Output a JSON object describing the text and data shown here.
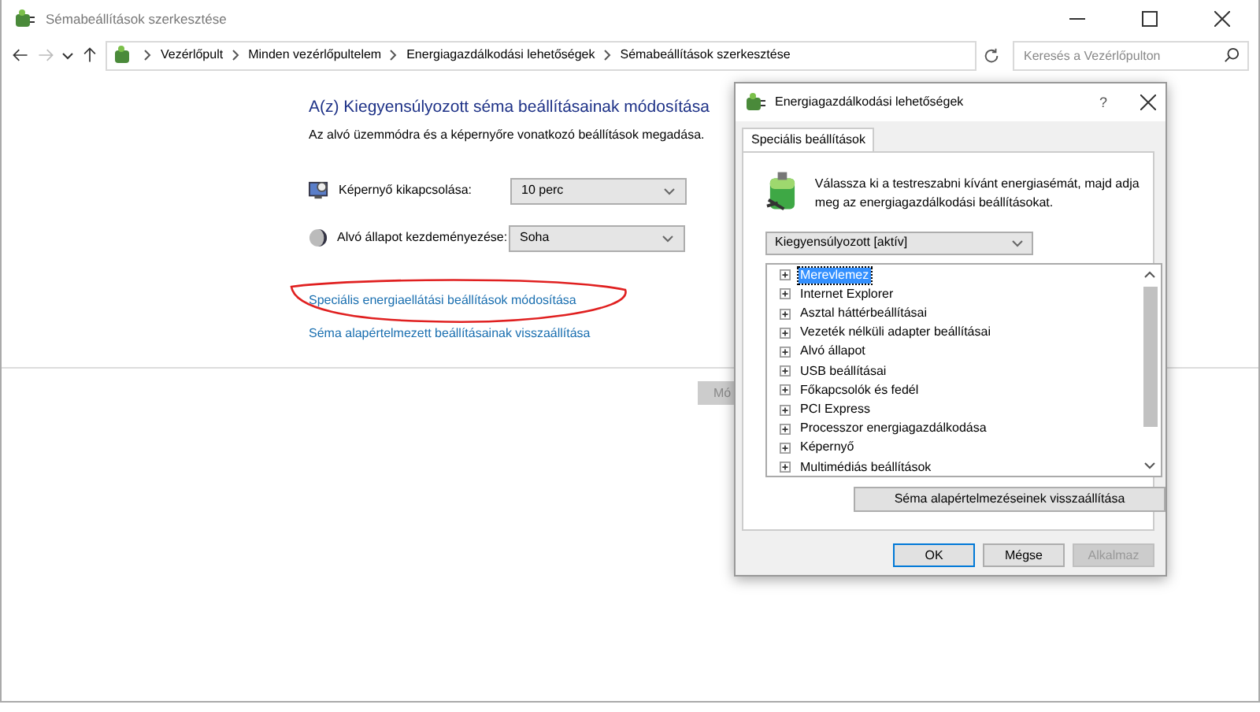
{
  "window": {
    "title": "Sémabeállítások szerkesztése"
  },
  "address_bar": {
    "breadcrumbs": [
      "Vezérlőpult",
      "Minden vezérlőpultelem",
      "Energiagazdálkodási lehetőségek",
      "Sémabeállítások szerkesztése"
    ]
  },
  "search": {
    "placeholder": "Keresés a Vezérlőpulton"
  },
  "heading": "A(z) Kiegyensúlyozott séma beállításainak módosítása",
  "subtitle": "Az alvó üzemmódra és a képernyőre vonatkozó beállítások megadása.",
  "settings": [
    {
      "kind": "display",
      "label": "Képernyő kikapcsolása:",
      "value": "10 perc"
    },
    {
      "kind": "sleep",
      "label": "Alvó állapot kezdeményezése:",
      "value": "Soha"
    }
  ],
  "links": [
    {
      "text": "Speciális energiaellátási beállítások módosítása",
      "circled": true
    },
    {
      "text": "Séma alapértelmezett beállításainak visszaállítása",
      "circled": false
    }
  ],
  "save_button": "Mó",
  "dialog": {
    "title": "Energiagazdálkodási lehetőségek",
    "help": "?",
    "tabs": [
      {
        "label": "Speciális beállítások",
        "selected": true
      }
    ],
    "description": "Válassza ki a testreszabni kívánt energiasémát, majd adja meg az energiagazdálkodási beállításokat.",
    "plan": "Kiegyensúlyozott [aktív]",
    "tree": [
      {
        "label": "Merevlemez",
        "selected": true
      },
      {
        "label": "Internet Explorer",
        "selected": false
      },
      {
        "label": "Asztal háttérbeállításai",
        "selected": false
      },
      {
        "label": "Vezeték nélküli adapter beállításai",
        "selected": false
      },
      {
        "label": "Alvó állapot",
        "selected": false
      },
      {
        "label": "USB beállításai",
        "selected": false
      },
      {
        "label": "Főkapcsolók és fedél",
        "selected": false
      },
      {
        "label": "PCI Express",
        "selected": false
      },
      {
        "label": "Processzor energiagazdálkodása",
        "selected": false
      },
      {
        "label": "Képernyő",
        "selected": false
      },
      {
        "label": "Multimédiás beállítások",
        "selected": false
      }
    ],
    "reset_button": "Séma alapértelmezéseinek visszaállítása",
    "buttons": [
      {
        "label": "OK",
        "default": true,
        "disabled": false
      },
      {
        "label": "Mégse",
        "default": false,
        "disabled": false
      },
      {
        "label": "Alkalmaz",
        "default": false,
        "disabled": true
      }
    ]
  }
}
